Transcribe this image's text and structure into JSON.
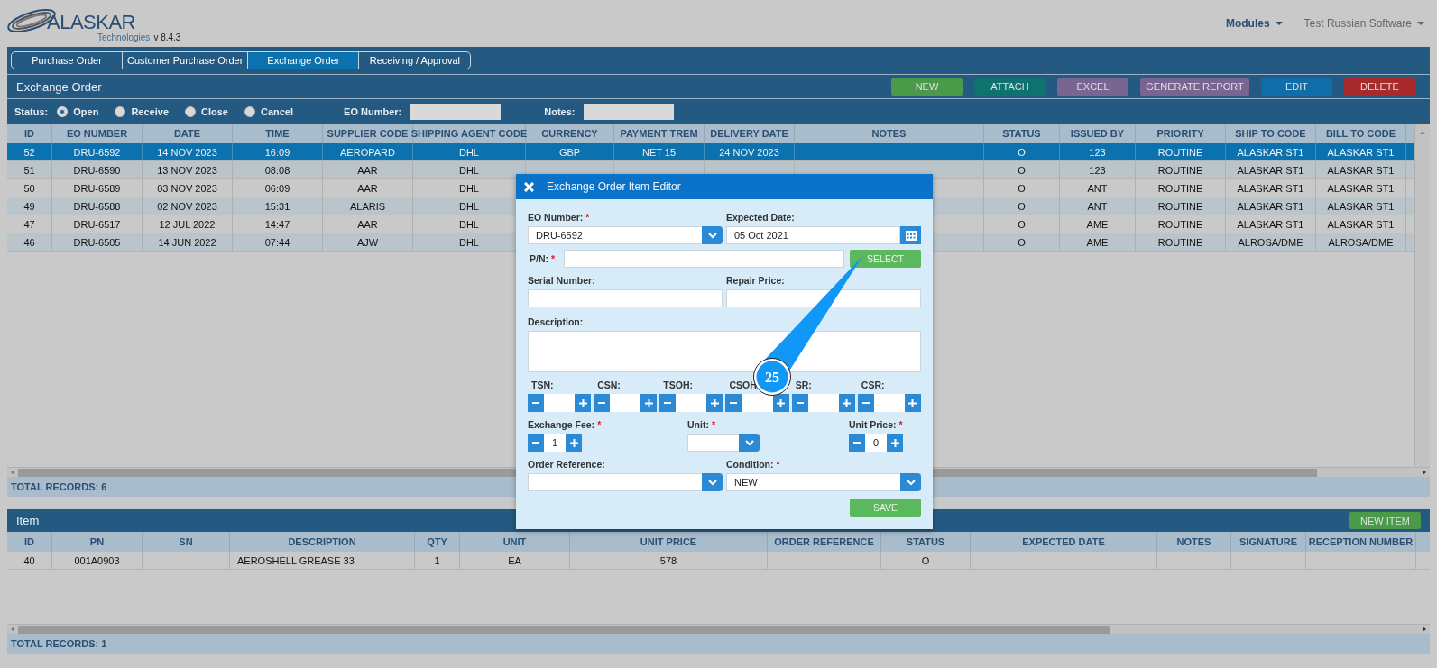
{
  "app": {
    "logo": "ALASKAR",
    "logo_sub": "Technologies",
    "version": "v 8.4.3"
  },
  "nav": [
    {
      "label": "Modules",
      "kind": "primary"
    },
    {
      "label": "Test Russian Software",
      "kind": "secondary"
    }
  ],
  "tabs": [
    {
      "label": "Purchase Order",
      "selected": false
    },
    {
      "label": "Customer Purchase Order",
      "selected": false
    },
    {
      "label": "Exchange Order",
      "selected": true
    },
    {
      "label": "Receiving / Approval",
      "selected": false
    }
  ],
  "panel": {
    "title": "Exchange Order",
    "buttons": [
      {
        "label": "NEW",
        "color": "#4a9a4a"
      },
      {
        "label": "ATTACH",
        "color": "#0e726f"
      },
      {
        "label": "EXCEL",
        "color": "#7a6592"
      },
      {
        "label": "GENERATE REPORT",
        "color": "#7a6592"
      },
      {
        "label": "EDIT",
        "color": "#0f6ea8"
      },
      {
        "label": "DELETE",
        "color": "#a82a2a"
      }
    ]
  },
  "filters": {
    "status_label": "Status:",
    "status_options": [
      {
        "label": "Open",
        "selected": true
      },
      {
        "label": "Receive",
        "selected": false
      },
      {
        "label": "Close",
        "selected": false
      },
      {
        "label": "Cancel",
        "selected": false
      }
    ],
    "fields": [
      {
        "label": "EO Number:"
      },
      {
        "label": "Notes:"
      }
    ]
  },
  "orders": {
    "columns": [
      "ID",
      "EO NUMBER",
      "DATE",
      "TIME",
      "SUPPLIER CODE",
      "SHIPPING AGENT CODE",
      "CURRENCY",
      "PAYMENT TREM",
      "DELIVERY DATE",
      "NOTES",
      "STATUS",
      "ISSUED BY",
      "PRIORITY",
      "SHIP TO CODE",
      "BILL TO CODE"
    ],
    "rows": [
      {
        "selected": true,
        "cells": [
          "52",
          "DRU-6592",
          "14 NOV 2023",
          "16:09",
          "AEROPARD",
          "DHL",
          "GBP",
          "NET 15",
          "24 NOV 2023",
          null,
          "O",
          "123",
          "ROUTINE",
          "ALASKAR ST1",
          "ALASKAR ST1"
        ]
      },
      {
        "selected": false,
        "cells": [
          "51",
          "DRU-6590",
          "13 NOV 2023",
          "08:08",
          "AAR",
          "DHL",
          null,
          null,
          null,
          null,
          "O",
          "123",
          "ROUTINE",
          "ALASKAR ST1",
          "ALASKAR ST1"
        ]
      },
      {
        "selected": false,
        "cells": [
          "50",
          "DRU-6589",
          "03 NOV 2023",
          "06:09",
          "AAR",
          "DHL",
          null,
          null,
          null,
          null,
          "O",
          "ANT",
          "ROUTINE",
          "ALASKAR ST1",
          "ALASKAR ST1"
        ]
      },
      {
        "selected": false,
        "cells": [
          "49",
          "DRU-6588",
          "02 NOV 2023",
          "15:31",
          "ALARIS",
          "DHL",
          null,
          null,
          null,
          null,
          "O",
          "ANT",
          "ROUTINE",
          "ALASKAR ST1",
          "ALASKAR ST1"
        ]
      },
      {
        "selected": false,
        "cells": [
          "47",
          "DRU-6517",
          "12 JUL 2022",
          "14:47",
          "AAR",
          "DHL",
          null,
          null,
          null,
          null,
          "O",
          "AME",
          "ROUTINE",
          "ALASKAR ST1",
          "ALASKAR ST1"
        ]
      },
      {
        "selected": false,
        "cells": [
          "46",
          "DRU-6505",
          "14 JUN 2022",
          "07:44",
          "AJW",
          "DHL",
          null,
          null,
          null,
          null,
          "O",
          "AME",
          "ROUTINE",
          "ALROSA/DME",
          "ALROSA/DME"
        ]
      }
    ],
    "total": "TOTAL RECORDS: 6"
  },
  "items": {
    "title": "Item",
    "button": "NEW ITEM",
    "columns": [
      "ID",
      "PN",
      "SN",
      "DESCRIPTION",
      "QTY",
      "UNIT",
      "UNIT PRICE",
      "ORDER REFERENCE",
      "STATUS",
      "EXPECTED DATE",
      "NOTES",
      "SIGNATURE",
      "RECEPTION NUMBER"
    ],
    "rows": [
      {
        "selected": false,
        "cells": [
          "40",
          "001A0903",
          null,
          "AEROSHELL GREASE 33",
          "1",
          "EA",
          "578",
          null,
          "O",
          null,
          null,
          null,
          null
        ]
      }
    ],
    "total": "TOTAL RECORDS: 1"
  },
  "dialog": {
    "title": "Exchange Order Item Editor",
    "eo_number": {
      "label": "EO Number:",
      "mark": "*",
      "value": "DRU-6592"
    },
    "expected_date": {
      "label": "Expected Date:",
      "value": "05 Oct 2021"
    },
    "pn": {
      "label": "P/N:",
      "mark": "*"
    },
    "select_button": "SELECT",
    "serial_number": {
      "label": "Serial Number:"
    },
    "repair_price": {
      "label": "Repair Price:"
    },
    "description": {
      "label": "Description:"
    },
    "counters": [
      {
        "label": "TSN:"
      },
      {
        "label": "CSN:"
      },
      {
        "label": "TSOH:"
      },
      {
        "label": "CSOH:"
      },
      {
        "label": "SR:"
      },
      {
        "label": "CSR:"
      }
    ],
    "exchange_fee": {
      "label": "Exchange Fee:",
      "mark": "*",
      "value": "1"
    },
    "unit": {
      "label": "Unit:",
      "mark": "*"
    },
    "unit_price": {
      "label": "Unit Price:",
      "mark": "*",
      "value": "0"
    },
    "order_reference": {
      "label": "Order Reference:"
    },
    "condition": {
      "label": "Condition:",
      "mark": "*",
      "value": "NEW"
    },
    "save_button": "SAVE"
  },
  "callout": {
    "number": "25"
  }
}
